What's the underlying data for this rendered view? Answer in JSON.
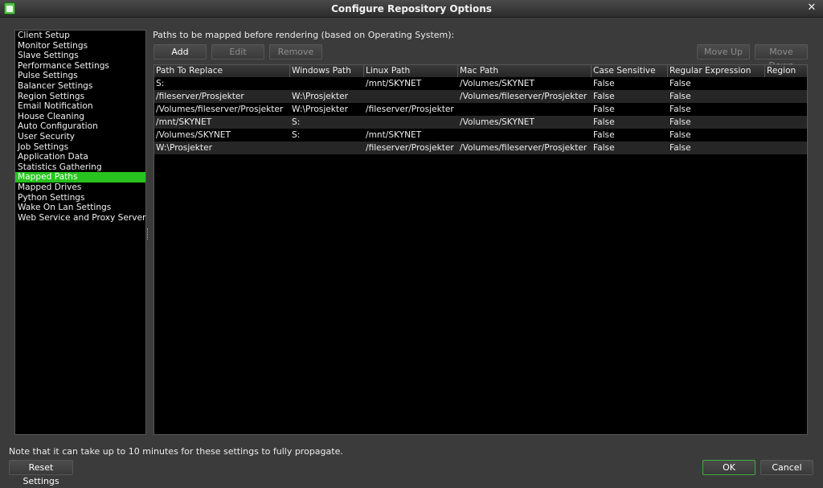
{
  "window": {
    "title": "Configure Repository Options"
  },
  "sidebar": {
    "items": [
      "Client Setup",
      "Monitor Settings",
      "Slave Settings",
      "Performance Settings",
      "Pulse Settings",
      "Balancer Settings",
      "Region Settings",
      "Email Notification",
      "House Cleaning",
      "Auto Configuration",
      "User Security",
      "Job Settings",
      "Application Data",
      "Statistics Gathering",
      "Mapped Paths",
      "Mapped Drives",
      "Python Settings",
      "Wake On Lan Settings",
      "Web Service and Proxy Server"
    ],
    "selected": "Mapped Paths"
  },
  "main": {
    "label": "Paths to be mapped before rendering (based on Operating System):",
    "buttons": {
      "add": "Add",
      "edit": "Edit",
      "remove": "Remove",
      "move_up": "Move Up",
      "move_down": "Move Down"
    },
    "table": {
      "columns": [
        "Path To Replace",
        "Windows Path",
        "Linux Path",
        "Mac Path",
        "Case Sensitive",
        "Regular Expression",
        "Region"
      ],
      "rows": [
        [
          "S:",
          "",
          "/mnt/SKYNET",
          "/Volumes/SKYNET",
          "False",
          "False",
          ""
        ],
        [
          "/fileserver/Prosjekter",
          "W:\\Prosjekter",
          "",
          "/Volumes/fileserver/Prosjekter",
          "False",
          "False",
          ""
        ],
        [
          "/Volumes/fileserver/Prosjekter",
          "W:\\Prosjekter",
          "/fileserver/Prosjekter",
          "",
          "False",
          "False",
          ""
        ],
        [
          "/mnt/SKYNET",
          "S:",
          "",
          "/Volumes/SKYNET",
          "False",
          "False",
          ""
        ],
        [
          "/Volumes/SKYNET",
          "S:",
          "/mnt/SKYNET",
          "",
          "False",
          "False",
          ""
        ],
        [
          "W:\\Prosjekter",
          "",
          "/fileserver/Prosjekter",
          "/Volumes/fileserver/Prosjekter",
          "False",
          "False",
          ""
        ]
      ]
    }
  },
  "footer": {
    "note": "Note that it can take up to 10 minutes for these settings to fully propagate.",
    "reset": "Reset Settings",
    "ok": "OK",
    "cancel": "Cancel"
  },
  "colors": {
    "selection": "#28c31f",
    "background": "#3b3b3b",
    "panel": "#000000"
  }
}
